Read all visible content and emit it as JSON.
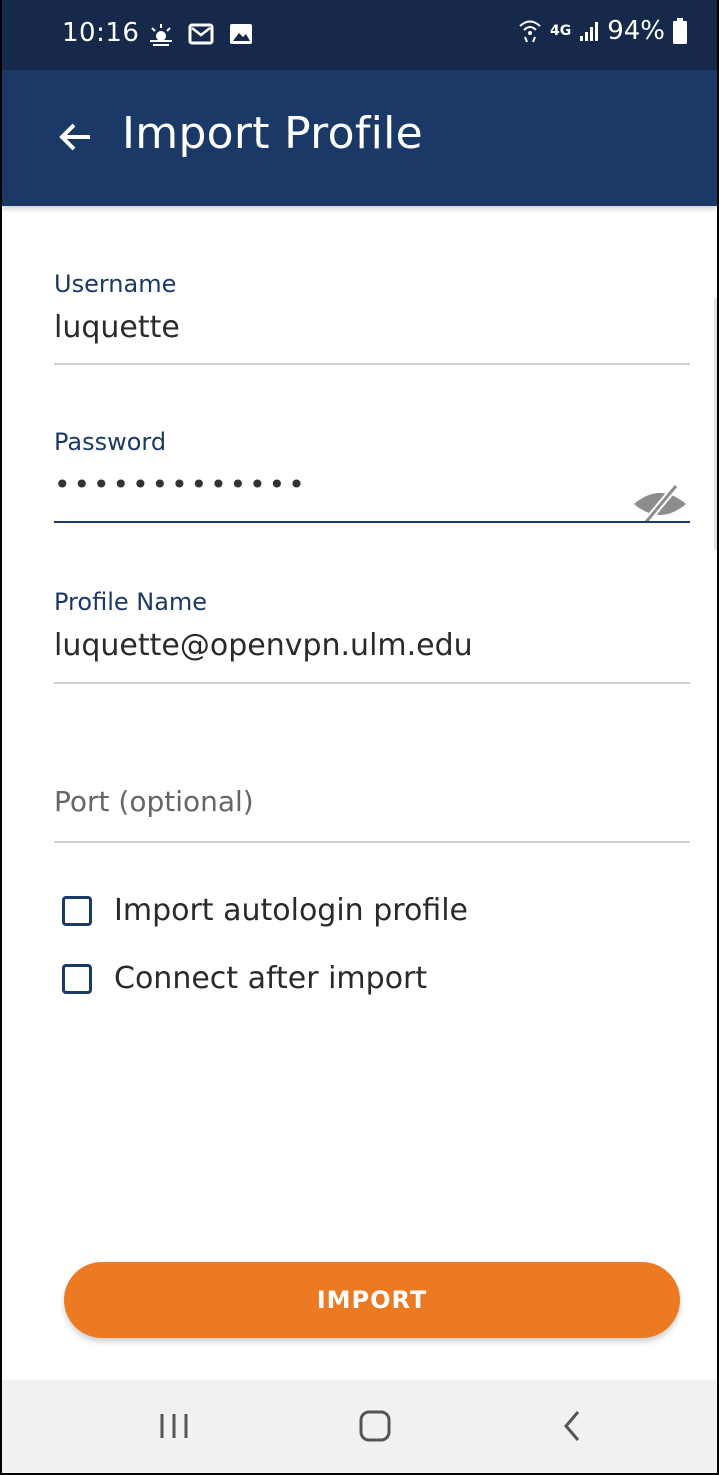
{
  "status_bar": {
    "time": "10:16",
    "left_icons": [
      "weather-icon",
      "email-icon",
      "image-icon"
    ],
    "network": "4G",
    "battery": "94%"
  },
  "app_bar": {
    "title": "Import Profile",
    "back_icon": "arrow-left-icon"
  },
  "form": {
    "username": {
      "label": "Username",
      "value": "luquette"
    },
    "password": {
      "label": "Password",
      "value": "•••••••••••••",
      "toggle_icon": "eye-off-icon"
    },
    "profile_name": {
      "label": "Profile Name",
      "value": "luquette@openvpn.ulm.edu"
    },
    "port": {
      "placeholder": "Port (optional)",
      "value": ""
    },
    "checkboxes": [
      {
        "label": "Import autologin profile",
        "checked": false
      },
      {
        "label": "Connect after import",
        "checked": false
      }
    ]
  },
  "import_button": {
    "label": "IMPORT"
  },
  "nav_bar": {
    "buttons": [
      "recent-apps-icon",
      "home-icon",
      "back-icon"
    ]
  },
  "colors": {
    "status_bar": "#17294a",
    "app_bar": "#1b3966",
    "accent": "#ec7a22",
    "label": "#1b3966"
  }
}
